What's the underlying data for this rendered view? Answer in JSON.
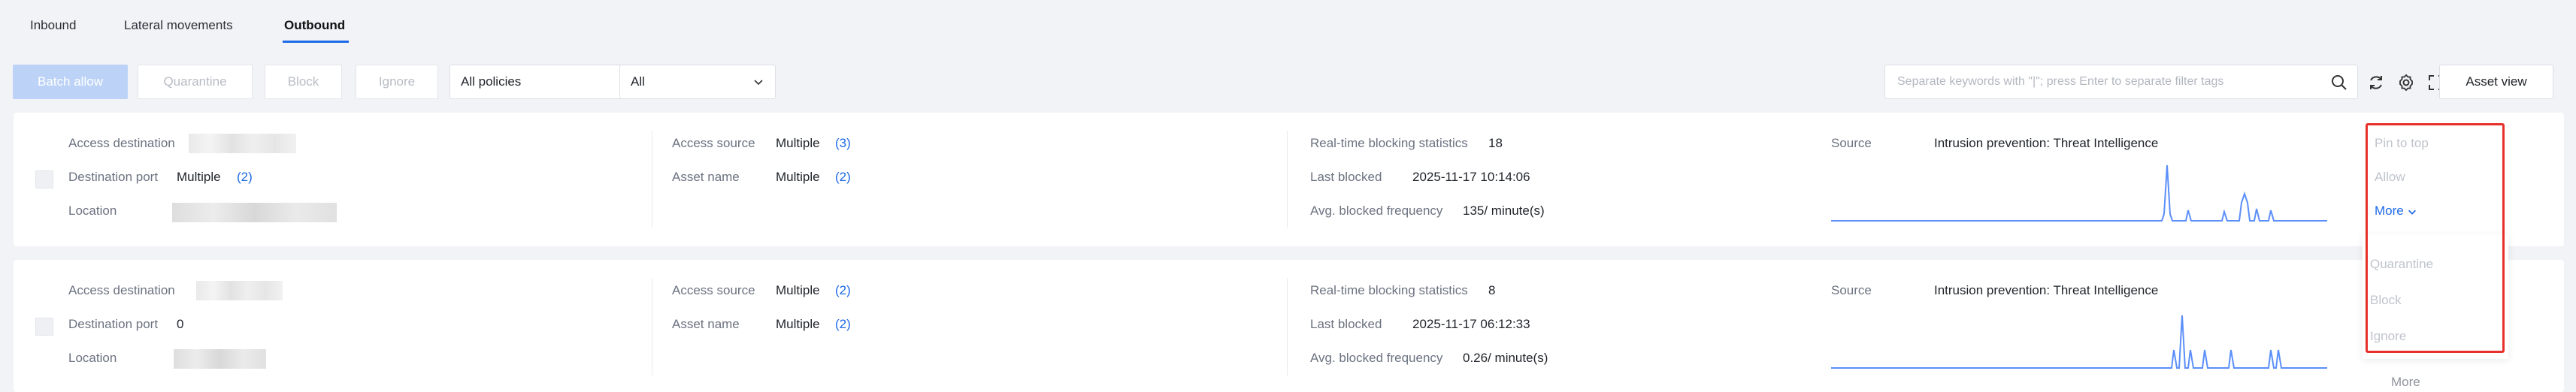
{
  "tabs": [
    {
      "label": "Inbound"
    },
    {
      "label": "Lateral movements"
    },
    {
      "label": "Outbound"
    }
  ],
  "toolbar": {
    "batch_allow": "Batch allow",
    "quarantine": "Quarantine",
    "block": "Block",
    "ignore": "Ignore",
    "policy_select": "All policies",
    "all_select": "All",
    "search_placeholder": "Separate keywords with \"|\"; press Enter to separate filter tags",
    "asset_view": "Asset view"
  },
  "labels": {
    "access_destination": "Access destination",
    "destination_port": "Destination port",
    "location": "Location",
    "access_source": "Access source",
    "asset_name": "Asset name",
    "realtime": "Real-time blocking statistics",
    "last_blocked": "Last blocked",
    "avg_freq": "Avg. blocked frequency",
    "source": "Source"
  },
  "rows": [
    {
      "destination_port": "Multiple",
      "destination_port_count": "(2)",
      "access_source": "Multiple",
      "access_source_count": "(3)",
      "asset_name": "Multiple",
      "asset_name_count": "(2)",
      "realtime_count": "18",
      "last_blocked": "2025-11-17 10:14:06",
      "avg_freq": "135/ minute(s)",
      "source": "Intrusion prevention: Threat Intelligence"
    },
    {
      "destination_port": "0",
      "access_source": "Multiple",
      "access_source_count": "(2)",
      "asset_name": "Multiple",
      "asset_name_count": "(2)",
      "realtime_count": "8",
      "last_blocked": "2025-11-17 06:12:33",
      "avg_freq": "0.26/ minute(s)",
      "source": "Intrusion prevention: Threat Intelligence"
    }
  ],
  "actions": {
    "pin_to_top": "Pin to top",
    "allow": "Allow",
    "more": "More"
  },
  "dropdown": {
    "items": [
      "Quarantine",
      "Block",
      "Ignore"
    ],
    "trailing": "More"
  },
  "colors": {
    "accent": "#1f6ae6",
    "sparkline": "#5b8ff9",
    "highlight": "#e8302a"
  }
}
